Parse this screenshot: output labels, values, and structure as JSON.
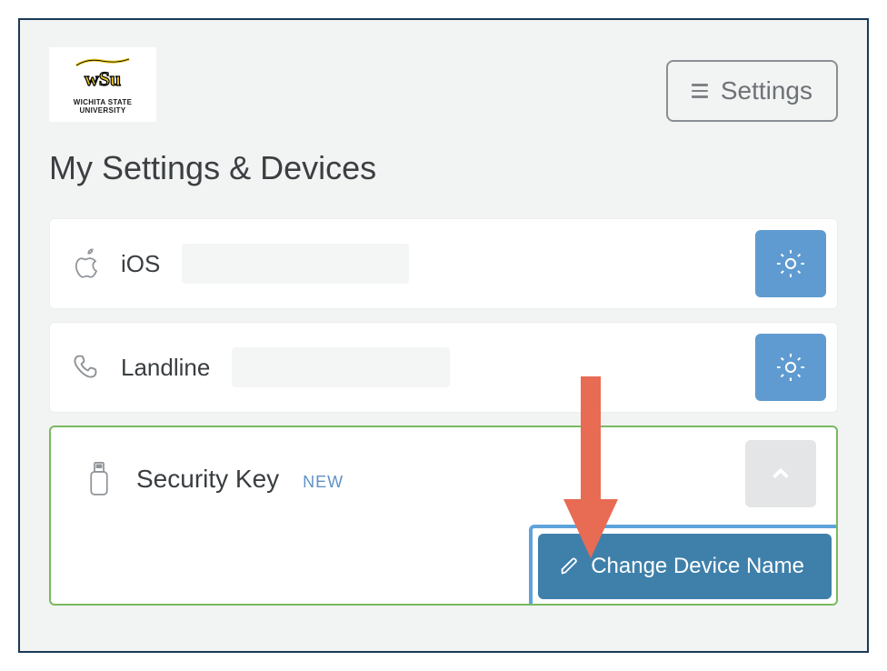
{
  "logo": {
    "line1": "WICHITA STATE",
    "line2": "UNIVERSITY"
  },
  "header": {
    "settings_label": "Settings"
  },
  "page_title": "My Settings & Devices",
  "devices": [
    {
      "label": "iOS",
      "icon": "apple-icon"
    },
    {
      "label": "Landline",
      "icon": "phone-icon"
    }
  ],
  "expanded": {
    "label": "Security Key",
    "badge": "NEW",
    "change_name_label": "Change Device Name"
  }
}
